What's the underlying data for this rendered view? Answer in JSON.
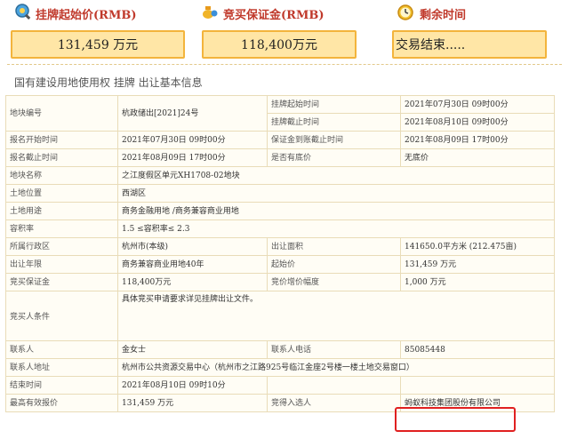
{
  "header": {
    "start_price_label": "挂牌起始价(RMB)",
    "deposit_label": "竞买保证金(RMB)",
    "remaining_label": "剩余时间",
    "start_price_value": "131,459 万元",
    "deposit_value": "118,400万元",
    "remaining_value": "交易结束....."
  },
  "section_title": "国有建设用地使用权 挂牌 出让基本信息",
  "rows": {
    "parcel_no_k": "地块编号",
    "parcel_no_v": "杭政储出[2021]24号",
    "list_start_k": "挂牌起始时间",
    "list_start_v": "2021年07月30日 09时00分",
    "list_end_k": "挂牌截止时间",
    "list_end_v": "2021年08月10日 09时00分",
    "reg_start_k": "报名开始时间",
    "reg_start_v": "2021年07月30日 09时00分",
    "deposit_deadline_k": "保证金到账截止时间",
    "deposit_deadline_v": "2021年08月09日 17时00分",
    "reg_end_k": "报名截止时间",
    "reg_end_v": "2021年08月09日 17时00分",
    "reserve_k": "是否有底价",
    "reserve_v": "无底价",
    "parcel_name_k": "地块名称",
    "parcel_name_v": "之江度假区单元XH1708-02地块",
    "location_k": "土地位置",
    "location_v": "西湖区",
    "use_k": "土地用途",
    "use_v": "商务金融用地 /商务兼容商业用地",
    "far_k": "容积率",
    "far_v": "1.5 ≤容积率≤ 2.3",
    "district_k": "所属行政区",
    "district_v": "杭州市(本级)",
    "area_k": "出让面积",
    "area_v": "141650.0平方米 (212.475亩)",
    "term_k": "出让年限",
    "term_v": "商务兼容商业用地40年",
    "start_price_k": "起始价",
    "start_price_v": "131,459 万元",
    "deposit_k": "竞买保证金",
    "deposit_v": "118,400万元",
    "increment_k": "竞价增价幅度",
    "increment_v": "1,000 万元",
    "conditions_k": "竞买人条件",
    "conditions_v": "具体竞买申请要求详见挂牌出让文件。",
    "contact_k": "联系人",
    "contact_v": "金女士",
    "phone_k": "联系人电话",
    "phone_v": "85085448",
    "address_k": "联系人地址",
    "address_v": "杭州市公共资源交易中心（杭州市之江路925号临江金座2号楼一楼土地交易窗口）",
    "end_time_k": "结束时间",
    "end_time_v": "2021年08月10日 09时10分",
    "top_bid_k": "最高有效报价",
    "top_bid_v": "131,459 万元",
    "winner_k": "竞得入选人",
    "winner_v": "蚂蚁科技集团股份有限公司"
  },
  "colors": {
    "label_red": "#c0392b",
    "box_fill": "#ffe6a6",
    "box_border": "#f3b43c",
    "highlight": "#e02020"
  },
  "icons": [
    "search-coin-icon",
    "money-bag-icon",
    "stopwatch-icon"
  ]
}
